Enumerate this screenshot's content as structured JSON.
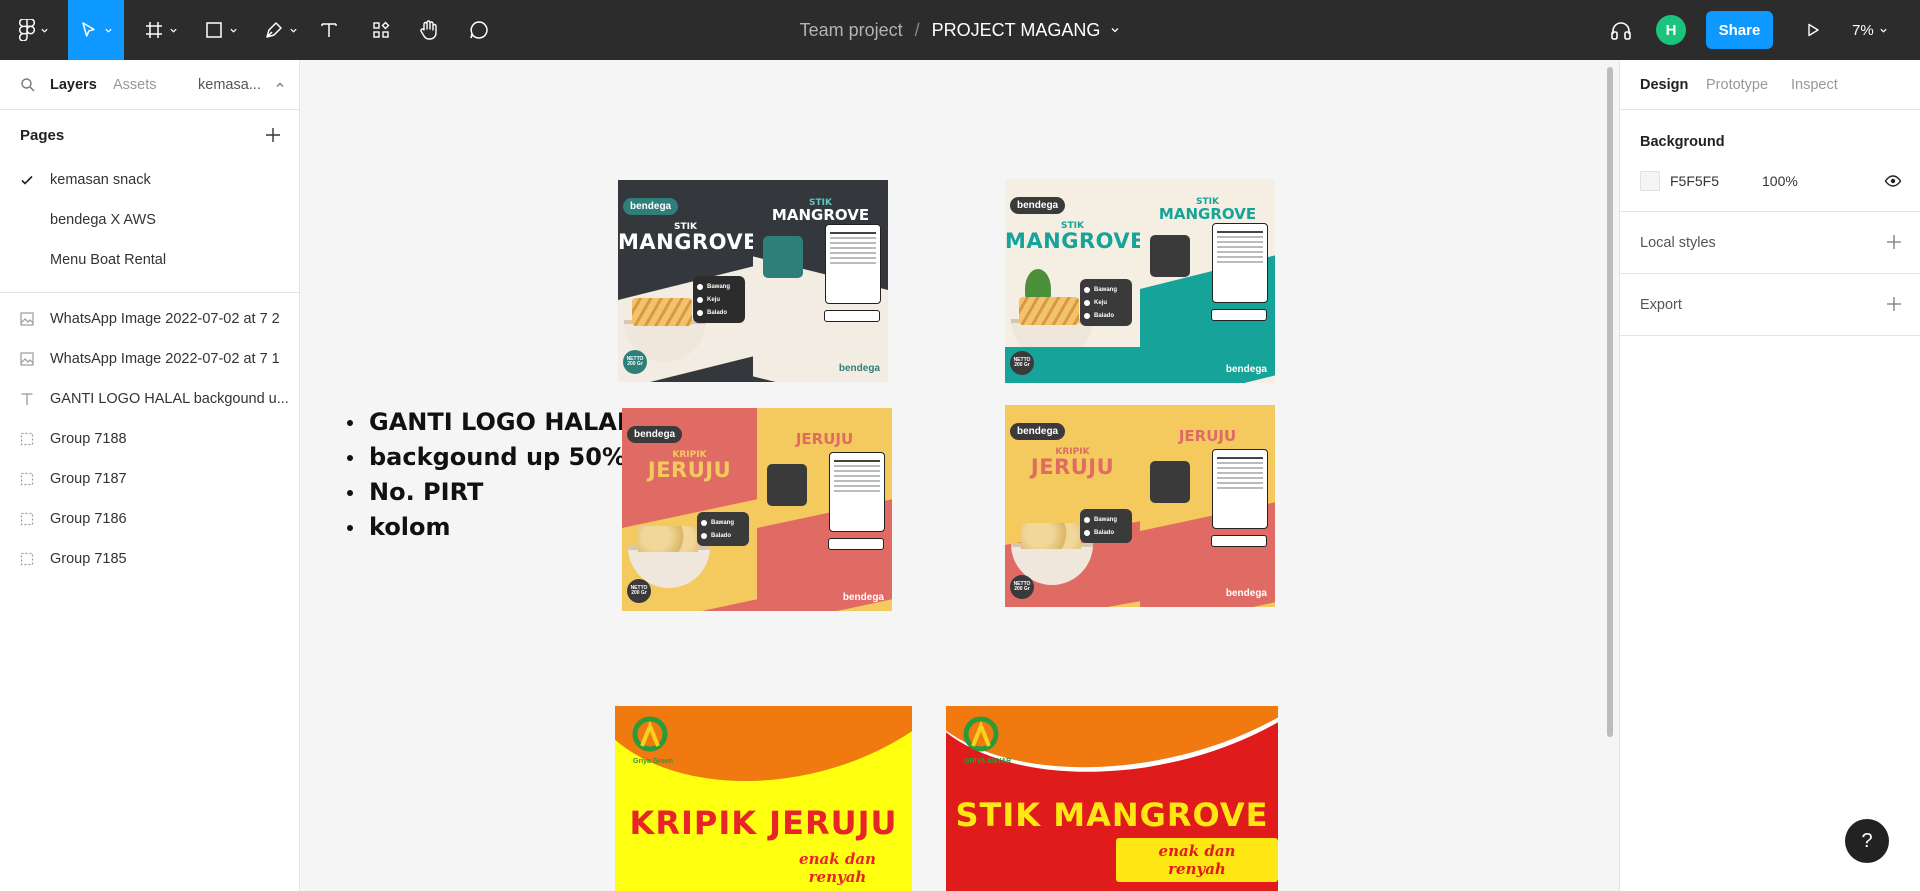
{
  "toolbar": {
    "project_crumb": "Team project",
    "separator": "/",
    "project_name": "PROJECT MAGANG",
    "avatar_initial": "H",
    "share_label": "Share",
    "zoom": "7%"
  },
  "left_panel": {
    "tabs": {
      "layers": "Layers",
      "assets": "Assets",
      "page_selector": "kemasa..."
    },
    "pages_title": "Pages",
    "pages": [
      {
        "label": "kemasan snack",
        "selected": true
      },
      {
        "label": "bendega X AWS",
        "selected": false
      },
      {
        "label": "Menu Boat Rental",
        "selected": false
      }
    ],
    "layers": [
      {
        "label": "WhatsApp Image 2022-07-02 at 7 2",
        "icon": "image-icon"
      },
      {
        "label": "WhatsApp Image 2022-07-02 at 7 1",
        "icon": "image-icon"
      },
      {
        "label": "GANTI LOGO HALAL backgound u...",
        "icon": "text-icon"
      },
      {
        "label": "Group 7188",
        "icon": "group-icon"
      },
      {
        "label": "Group 7187",
        "icon": "group-icon"
      },
      {
        "label": "Group 7186",
        "icon": "group-icon"
      },
      {
        "label": "Group 7185",
        "icon": "group-icon"
      }
    ]
  },
  "right_panel": {
    "tabs": {
      "design": "Design",
      "prototype": "Prototype",
      "inspect": "Inspect"
    },
    "background": {
      "title": "Background",
      "hex": "F5F5F5",
      "opacity": "100%",
      "color": "#f5f5f5"
    },
    "local_styles": "Local styles",
    "export": "Export"
  },
  "canvas": {
    "notes": [
      "GANTI LOGO HALAL",
      "backgound up 50%",
      "No. PIRT",
      "kolom"
    ],
    "packs": [
      {
        "brand": "bendega",
        "pre": "STIK",
        "title": "MANGROVE",
        "pre_right": "STIK",
        "title_right": "MANGROVE",
        "flavors": [
          "Bawang",
          "Keju",
          "Balado"
        ],
        "netto": "NETTO 200 Gr"
      },
      {
        "brand": "bendega",
        "pre": "STIK",
        "title": "MANGROVE",
        "pre_right": "STIK",
        "title_right": "MANGROVE",
        "flavors": [
          "Bawang",
          "Keju",
          "Balado"
        ],
        "netto": "NETTO 200 Gr"
      },
      {
        "brand": "bendega",
        "pre": "KRIPIK",
        "title": "JERUJU",
        "pre_right": "",
        "title_right": "JERUJU",
        "flavors": [
          "Bawang",
          "Balado"
        ],
        "netto": "NETTO 200 Gr"
      },
      {
        "brand": "bendega",
        "pre": "KRIPIK",
        "title": "JERUJU",
        "pre_right": "",
        "title_right": "JERUJU",
        "flavors": [
          "Bawang",
          "Balado"
        ],
        "netto": "NETTO 200 Gr"
      }
    ],
    "griya_packs": [
      {
        "logo_text": "Griya Green",
        "title": "KRIPIK JERUJU",
        "tagline": "enak dan renyah"
      },
      {
        "logo_text": "GRIYA ANYAR",
        "title": "STIK MANGROVE",
        "tagline": "enak dan renyah"
      }
    ]
  },
  "help_label": "?",
  "colors": {
    "accent": "#0d99ff",
    "toolbar": "#2c2c2c",
    "avatar": "#1bc47d"
  }
}
